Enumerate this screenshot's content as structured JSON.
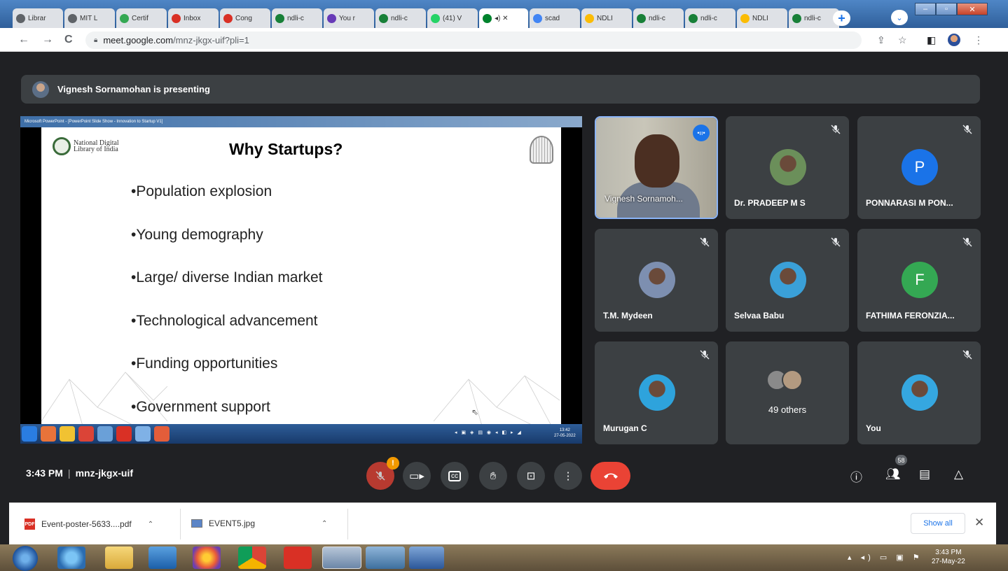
{
  "browser": {
    "tabs": [
      {
        "label": "Librar",
        "icon": "globe-icon",
        "color": "#5f6368"
      },
      {
        "label": "MIT L",
        "icon": "globe-icon",
        "color": "#5f6368"
      },
      {
        "label": "Certif",
        "icon": "certificate-icon",
        "color": "#34a853"
      },
      {
        "label": "Inbox",
        "icon": "gmail-icon",
        "color": "#d93025"
      },
      {
        "label": "Cong",
        "icon": "gmail-icon",
        "color": "#d93025"
      },
      {
        "label": "ndli-c",
        "icon": "globe-icon",
        "color": "#188038"
      },
      {
        "label": "You r",
        "icon": "forms-icon",
        "color": "#673ab7"
      },
      {
        "label": "ndli-c",
        "icon": "globe-icon",
        "color": "#188038"
      },
      {
        "label": "(41) V",
        "icon": "whatsapp-icon",
        "color": "#25d366"
      },
      {
        "label": "",
        "icon": "meet-icon",
        "color": "#00832d",
        "active": true
      },
      {
        "label": "scad",
        "icon": "google-icon",
        "color": "#4285f4"
      },
      {
        "label": "NDLI",
        "icon": "drive-icon",
        "color": "#fbbc04"
      },
      {
        "label": "ndli-c",
        "icon": "globe-icon",
        "color": "#188038"
      },
      {
        "label": "ndli-c",
        "icon": "globe-icon",
        "color": "#188038"
      },
      {
        "label": "NDLI",
        "icon": "drive-icon",
        "color": "#fbbc04"
      },
      {
        "label": "ndli-c",
        "icon": "globe-icon",
        "color": "#188038"
      }
    ],
    "url_host": "meet.google.com",
    "url_path": "/mnz-jkgx-uif?pli=1"
  },
  "meet": {
    "presenting": "Vignesh Sornamohan is presenting",
    "slide": {
      "window_title": "Microsoft PowerPoint - [PowerPoint Slide Show - Innovation to Startup V1]",
      "logo": "National Digital Library of India",
      "title": "Why Startups?",
      "bullets": [
        "•Population explosion",
        "•Young demography",
        "•Large/ diverse Indian market",
        "•Technological advancement",
        "•Funding opportunities",
        "•Government support"
      ],
      "clock_time": "13:42",
      "clock_date": "27-05-2022"
    },
    "participants": [
      {
        "name": "Vignesh Sornamoh...",
        "type": "video"
      },
      {
        "name": "Dr. PRADEEP M S",
        "type": "photo",
        "avatar_color": "#6b8f5a"
      },
      {
        "name": "PONNARASI M PON...",
        "type": "letter",
        "letter": "P",
        "avatar_color": "#1a73e8"
      },
      {
        "name": "T.M. Mydeen",
        "type": "photo",
        "avatar_color": "#7d8fb0"
      },
      {
        "name": "Selvaa Babu",
        "type": "photo",
        "avatar_color": "#3aa0d8"
      },
      {
        "name": "FATHIMA FERONZIA...",
        "type": "letter",
        "letter": "F",
        "avatar_color": "#34a853"
      },
      {
        "name": "Murugan C",
        "type": "photo",
        "avatar_color": "#2ea3dc"
      },
      {
        "name": "",
        "type": "others",
        "label": "49 others"
      },
      {
        "name": "You",
        "type": "photo",
        "avatar_color": "#35a7e0"
      }
    ],
    "meeting_time": "3:43 PM",
    "meeting_code": "mnz-jkgx-uif",
    "people_count": "58",
    "alert_badge": "!"
  },
  "downloads": {
    "items": [
      {
        "name": "Event-poster-5633....pdf",
        "icon": "pdf-icon"
      },
      {
        "name": "EVENT5.jpg",
        "icon": "image-icon"
      }
    ],
    "show_all": "Show all"
  },
  "taskbar": {
    "clock_time": "3:43 PM",
    "clock_date": "27-May-22"
  },
  "colors": {
    "meet_bg": "#202124",
    "tile_bg": "#3c4043",
    "hangup": "#ea4335",
    "accent": "#1a73e8"
  }
}
